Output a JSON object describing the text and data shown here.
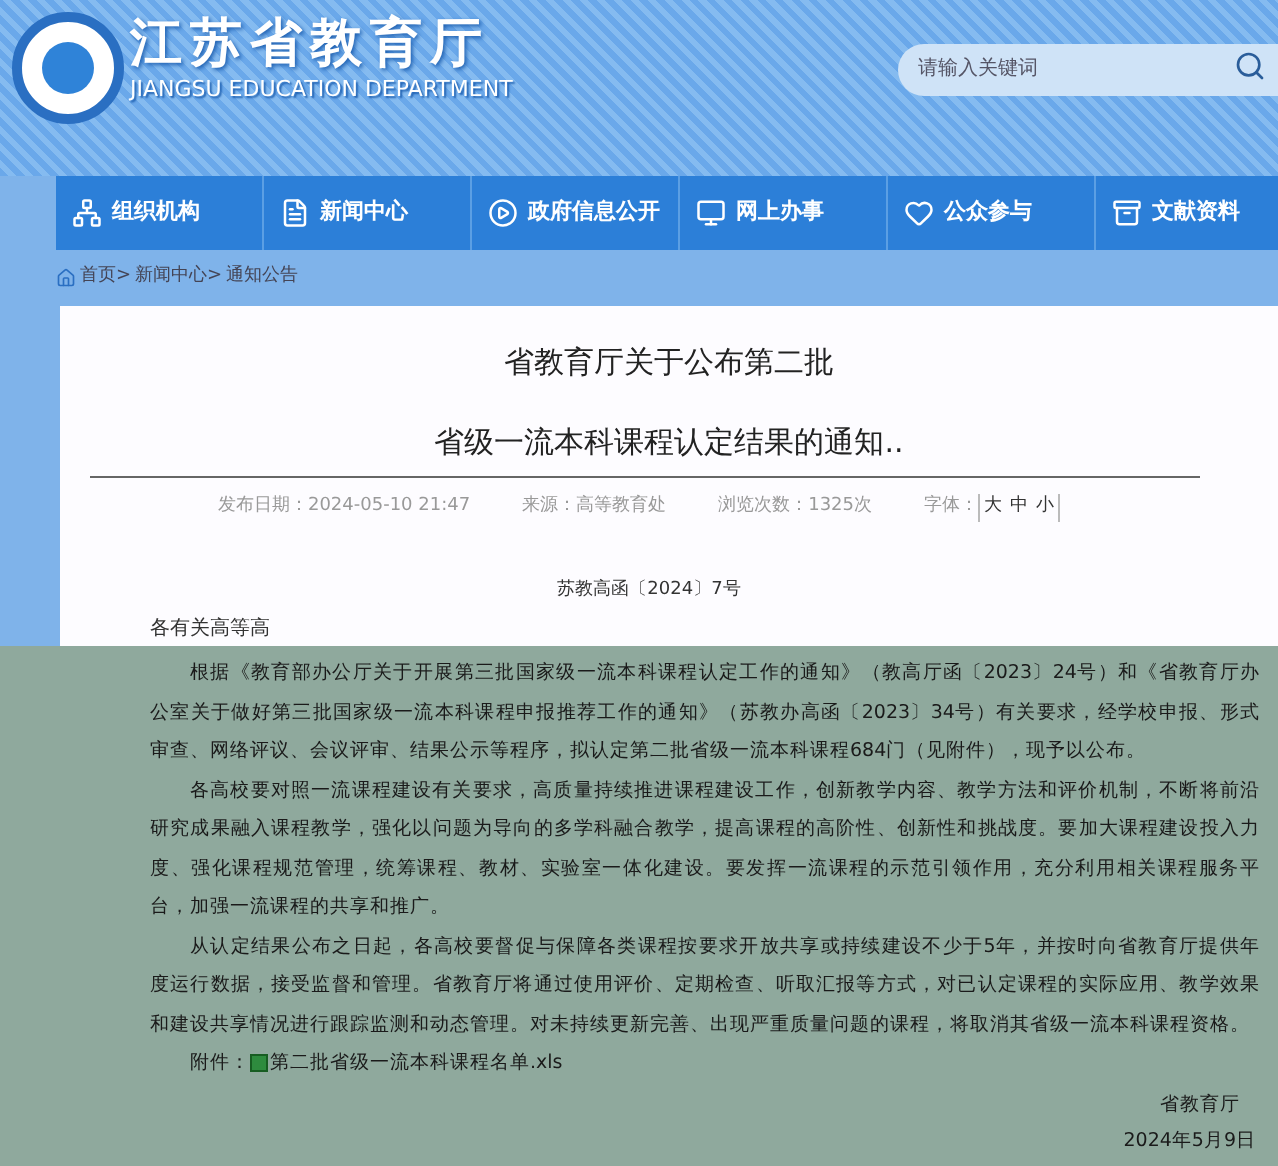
{
  "header": {
    "title": "江苏省教育厅",
    "subtitle": "JIANGSU EDUCATION DEPARTMENT",
    "search": {
      "placeholder": "请输入关键词"
    }
  },
  "nav": [
    {
      "label": "组织机构",
      "kind": "org"
    },
    {
      "label": "新闻中心",
      "kind": "doc"
    },
    {
      "label": "政府信息公开",
      "kind": "play"
    },
    {
      "label": "网上办事",
      "kind": "monitor"
    },
    {
      "label": "公众参与",
      "kind": "heart"
    },
    {
      "label": "文献资料",
      "kind": "archive"
    }
  ],
  "breadcrumb": [
    "首页>",
    "新闻中心>",
    "通知公告"
  ],
  "article": {
    "title_lines": [
      "省教育厅关于公布第二批",
      "省级一流本科课程认定结果的通知.."
    ],
    "meta": [
      "发布日期：2024-05-10 21:47",
      "来源：高等教育处",
      "浏览次数：1325次"
    ],
    "font_label": "字体：",
    "font_sizes": [
      "大",
      "中",
      "小"
    ],
    "doc_number": "苏教高函〔2024〕7号",
    "salutation": "各有关高等高",
    "paragraphs": [
      "根据《教育部办公厅关于开展第三批国家级一流本科课程认定工作的通知》（教高厅函〔2023〕24号）和《省教育厅办公室关于做好第三批国家级一流本科课程申报推荐工作的通知》（苏教办高函〔2023〕34号）有关要求，经学校申报、形式审查、网络评议、会议评审、结果公示等程序，拟认定第二批省级一流本科课程684门（见附件），现予以公布。",
      "各高校要对照一流课程建设有关要求，高质量持续推进课程建设工作，创新教学内容、教学方法和评价机制，不断将前沿研究成果融入课程教学，强化以问题为导向的多学科融合教学，提高课程的高阶性、创新性和挑战度。要加大课程建设投入力度、强化课程规范管理，统筹课程、教材、实验室一体化建设。要发挥一流课程的示范引领作用，充分利用相关课程服务平台，加强一流课程的共享和推广。",
      "从认定结果公布之日起，各高校要督促与保障各类课程按要求开放共享或持续建设不少于5年，并按时向省教育厅提供年度运行数据，接受监督和管理。省教育厅将通过使用评价、定期检查、听取汇报等方式，对已认定课程的实际应用、教学效果和建设共享情况进行跟踪监测和动态管理。对未持续更新完善、出现严重质量问题的课程，将取消其省级一流本科课程资格。"
    ],
    "attachment_label": "附件：",
    "attachment": "第二批省级一流本科课程名单.xls",
    "signature": "省教育厅",
    "date": "2024年5月9日"
  }
}
